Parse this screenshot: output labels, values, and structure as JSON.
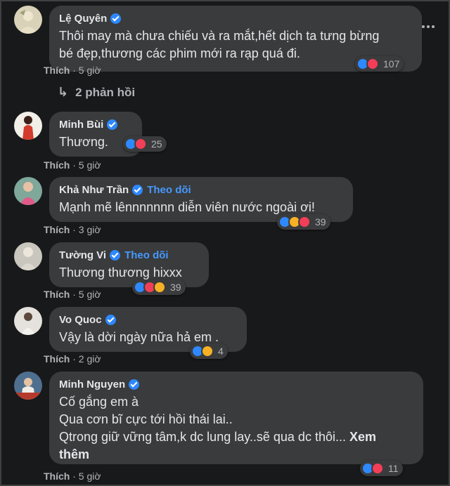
{
  "comments": [
    {
      "name": "Lệ Quyên",
      "follow": "",
      "lines": [
        "Thôi may mà chưa chiếu và ra mắt,hết dịch ta tưng bừng",
        "bé đẹp,thương các phim mới ra rạp quá đi."
      ],
      "like": "Thích",
      "time": "5 giờ",
      "reaction_count": "107"
    },
    {
      "name": "Minh Bùi",
      "follow": "",
      "lines": [
        "Thương."
      ],
      "like": "Thích",
      "time": "5 giờ",
      "reaction_count": "25"
    },
    {
      "name": "Khả Như Trần",
      "follow": "Theo dõi",
      "lines": [
        "Mạnh mẽ lênnnnnnn diễn viên nước ngoài ơi!"
      ],
      "like": "Thích",
      "time": "3 giờ",
      "reaction_count": "39"
    },
    {
      "name": "Tường Vi",
      "follow": "Theo dõi",
      "lines": [
        "Thương thương hixxx"
      ],
      "like": "Thích",
      "time": "5 giờ",
      "reaction_count": "39"
    },
    {
      "name": "Vo Quoc",
      "follow": "",
      "lines": [
        "Vậy là dời ngày nữa hả em ."
      ],
      "like": "Thích",
      "time": "2 giờ",
      "reaction_count": "4"
    },
    {
      "name": "Minh Nguyen",
      "follow": "",
      "lines": [
        "Cố gắng em à",
        "Qua cơn bĩ cực tới hồi thái lai..",
        "Qtrong giữ vững tâm,k dc lung lay..sẽ qua dc thôi..."
      ],
      "see_more": "Xem",
      "see_more2": "thêm",
      "like": "Thích",
      "time": "5 giờ",
      "reaction_count": "11"
    }
  ],
  "replies_label": "2 phản hồi",
  "time_sep": "·",
  "icons": {
    "menu": "more-horizontal-icon",
    "reply_arrow": "reply-arrow-icon",
    "verified": "verified-badge-icon"
  },
  "colors": {
    "background": "#18191a",
    "bubble": "#3a3b3c",
    "link": "#4599ff"
  }
}
